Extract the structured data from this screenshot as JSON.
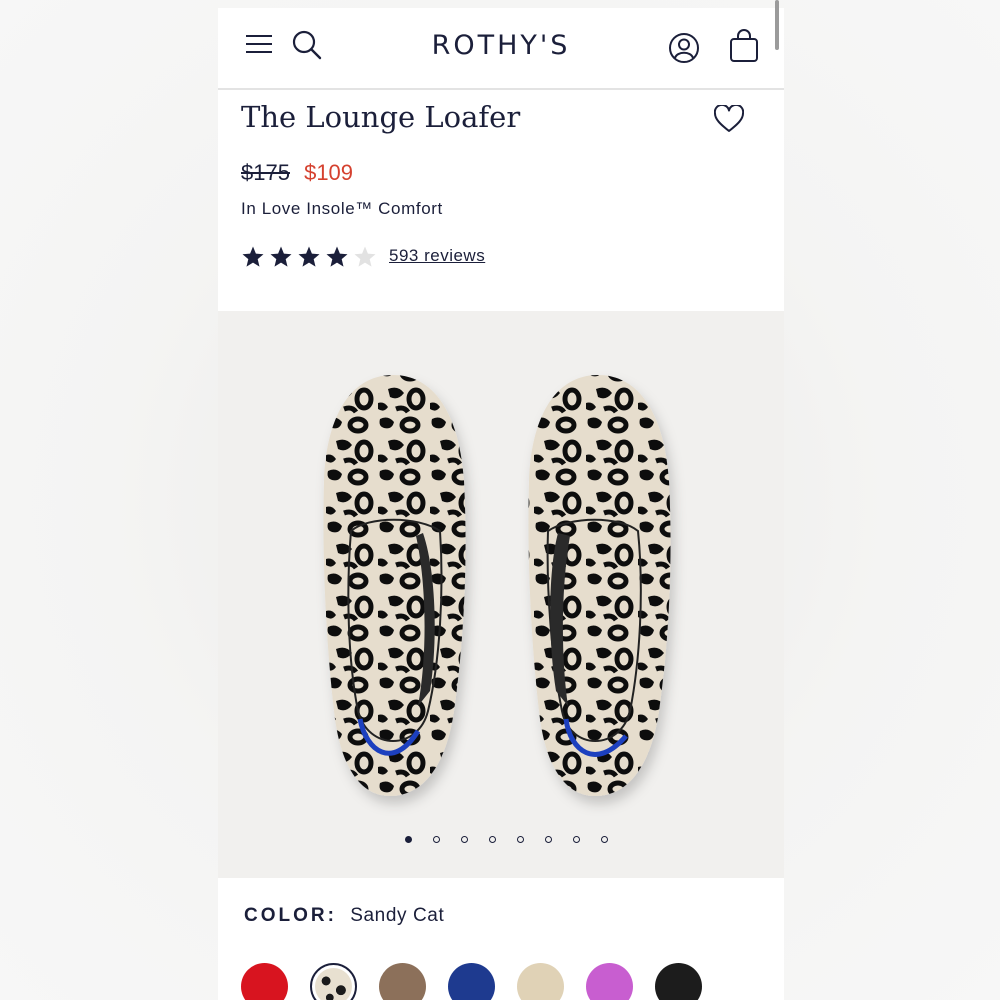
{
  "header": {
    "brand": "ROTHY'S",
    "icons": [
      "menu-icon",
      "search-icon",
      "account-icon",
      "shopping-bag-icon"
    ]
  },
  "product": {
    "title": "The Lounge Loafer",
    "price_original": "$175",
    "price_sale": "$109",
    "subtitle": "In Love Insole™ Comfort",
    "rating": 4,
    "rating_max": 5,
    "reviews_label": "593 reviews"
  },
  "gallery": {
    "image_count": 8,
    "active_index": 0
  },
  "color": {
    "label": "COLOR:",
    "selected": "Sandy Cat",
    "swatches": [
      "#d8141f",
      "sandy-cat-pattern",
      "#8c705a",
      "#1e3a8f",
      "#e0d2b6",
      "#c85ed0",
      "#1c1c1c"
    ]
  },
  "colors": {
    "navy": "#1b1f3a",
    "sale_red": "#d5412f",
    "gallery_bg": "#f1f0ee"
  }
}
